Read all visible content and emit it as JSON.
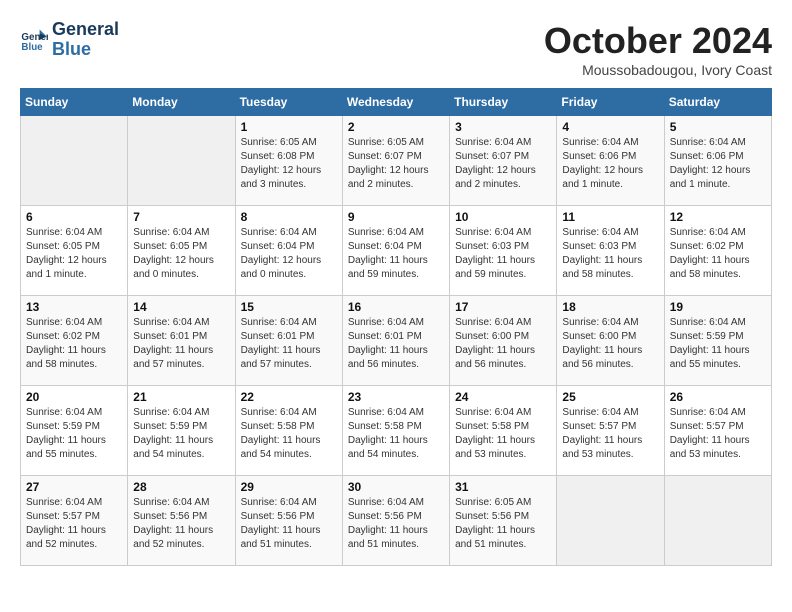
{
  "logo": {
    "line1": "General",
    "line2": "Blue"
  },
  "title": "October 2024",
  "subtitle": "Moussobadougou, Ivory Coast",
  "weekdays": [
    "Sunday",
    "Monday",
    "Tuesday",
    "Wednesday",
    "Thursday",
    "Friday",
    "Saturday"
  ],
  "weeks": [
    [
      {
        "day": "",
        "detail": ""
      },
      {
        "day": "",
        "detail": ""
      },
      {
        "day": "1",
        "detail": "Sunrise: 6:05 AM\nSunset: 6:08 PM\nDaylight: 12 hours\nand 3 minutes."
      },
      {
        "day": "2",
        "detail": "Sunrise: 6:05 AM\nSunset: 6:07 PM\nDaylight: 12 hours\nand 2 minutes."
      },
      {
        "day": "3",
        "detail": "Sunrise: 6:04 AM\nSunset: 6:07 PM\nDaylight: 12 hours\nand 2 minutes."
      },
      {
        "day": "4",
        "detail": "Sunrise: 6:04 AM\nSunset: 6:06 PM\nDaylight: 12 hours\nand 1 minute."
      },
      {
        "day": "5",
        "detail": "Sunrise: 6:04 AM\nSunset: 6:06 PM\nDaylight: 12 hours\nand 1 minute."
      }
    ],
    [
      {
        "day": "6",
        "detail": "Sunrise: 6:04 AM\nSunset: 6:05 PM\nDaylight: 12 hours\nand 1 minute."
      },
      {
        "day": "7",
        "detail": "Sunrise: 6:04 AM\nSunset: 6:05 PM\nDaylight: 12 hours\nand 0 minutes."
      },
      {
        "day": "8",
        "detail": "Sunrise: 6:04 AM\nSunset: 6:04 PM\nDaylight: 12 hours\nand 0 minutes."
      },
      {
        "day": "9",
        "detail": "Sunrise: 6:04 AM\nSunset: 6:04 PM\nDaylight: 11 hours\nand 59 minutes."
      },
      {
        "day": "10",
        "detail": "Sunrise: 6:04 AM\nSunset: 6:03 PM\nDaylight: 11 hours\nand 59 minutes."
      },
      {
        "day": "11",
        "detail": "Sunrise: 6:04 AM\nSunset: 6:03 PM\nDaylight: 11 hours\nand 58 minutes."
      },
      {
        "day": "12",
        "detail": "Sunrise: 6:04 AM\nSunset: 6:02 PM\nDaylight: 11 hours\nand 58 minutes."
      }
    ],
    [
      {
        "day": "13",
        "detail": "Sunrise: 6:04 AM\nSunset: 6:02 PM\nDaylight: 11 hours\nand 58 minutes."
      },
      {
        "day": "14",
        "detail": "Sunrise: 6:04 AM\nSunset: 6:01 PM\nDaylight: 11 hours\nand 57 minutes."
      },
      {
        "day": "15",
        "detail": "Sunrise: 6:04 AM\nSunset: 6:01 PM\nDaylight: 11 hours\nand 57 minutes."
      },
      {
        "day": "16",
        "detail": "Sunrise: 6:04 AM\nSunset: 6:01 PM\nDaylight: 11 hours\nand 56 minutes."
      },
      {
        "day": "17",
        "detail": "Sunrise: 6:04 AM\nSunset: 6:00 PM\nDaylight: 11 hours\nand 56 minutes."
      },
      {
        "day": "18",
        "detail": "Sunrise: 6:04 AM\nSunset: 6:00 PM\nDaylight: 11 hours\nand 56 minutes."
      },
      {
        "day": "19",
        "detail": "Sunrise: 6:04 AM\nSunset: 5:59 PM\nDaylight: 11 hours\nand 55 minutes."
      }
    ],
    [
      {
        "day": "20",
        "detail": "Sunrise: 6:04 AM\nSunset: 5:59 PM\nDaylight: 11 hours\nand 55 minutes."
      },
      {
        "day": "21",
        "detail": "Sunrise: 6:04 AM\nSunset: 5:59 PM\nDaylight: 11 hours\nand 54 minutes."
      },
      {
        "day": "22",
        "detail": "Sunrise: 6:04 AM\nSunset: 5:58 PM\nDaylight: 11 hours\nand 54 minutes."
      },
      {
        "day": "23",
        "detail": "Sunrise: 6:04 AM\nSunset: 5:58 PM\nDaylight: 11 hours\nand 54 minutes."
      },
      {
        "day": "24",
        "detail": "Sunrise: 6:04 AM\nSunset: 5:58 PM\nDaylight: 11 hours\nand 53 minutes."
      },
      {
        "day": "25",
        "detail": "Sunrise: 6:04 AM\nSunset: 5:57 PM\nDaylight: 11 hours\nand 53 minutes."
      },
      {
        "day": "26",
        "detail": "Sunrise: 6:04 AM\nSunset: 5:57 PM\nDaylight: 11 hours\nand 53 minutes."
      }
    ],
    [
      {
        "day": "27",
        "detail": "Sunrise: 6:04 AM\nSunset: 5:57 PM\nDaylight: 11 hours\nand 52 minutes."
      },
      {
        "day": "28",
        "detail": "Sunrise: 6:04 AM\nSunset: 5:56 PM\nDaylight: 11 hours\nand 52 minutes."
      },
      {
        "day": "29",
        "detail": "Sunrise: 6:04 AM\nSunset: 5:56 PM\nDaylight: 11 hours\nand 51 minutes."
      },
      {
        "day": "30",
        "detail": "Sunrise: 6:04 AM\nSunset: 5:56 PM\nDaylight: 11 hours\nand 51 minutes."
      },
      {
        "day": "31",
        "detail": "Sunrise: 6:05 AM\nSunset: 5:56 PM\nDaylight: 11 hours\nand 51 minutes."
      },
      {
        "day": "",
        "detail": ""
      },
      {
        "day": "",
        "detail": ""
      }
    ]
  ]
}
